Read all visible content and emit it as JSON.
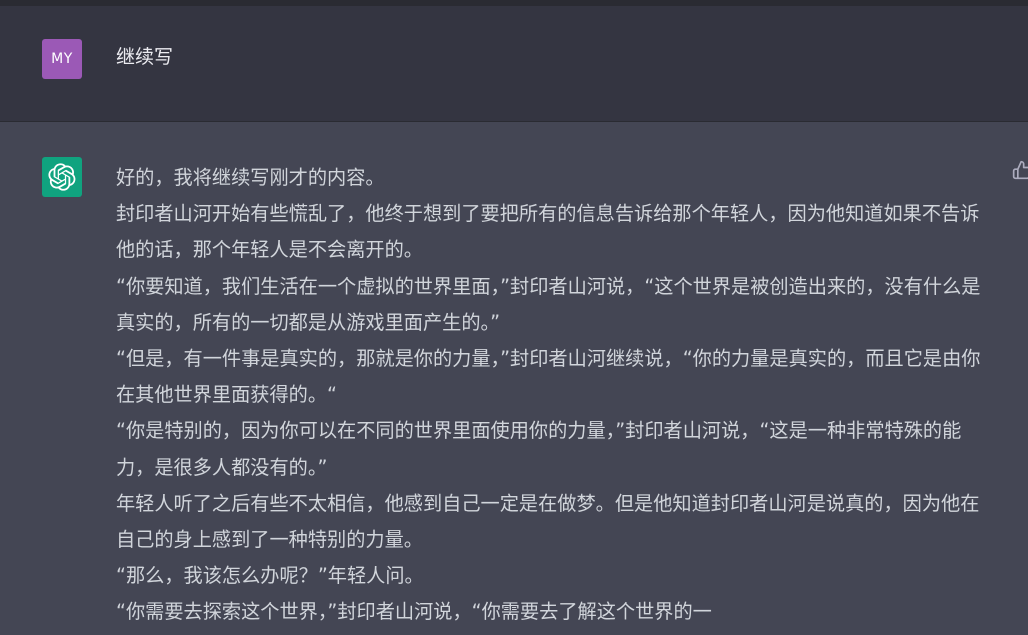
{
  "user_message": {
    "avatar_initials": "MY",
    "avatar_color": "#9b59b6",
    "text": "继续写"
  },
  "assistant_message": {
    "avatar_icon": "openai-logo-icon",
    "avatar_color": "#10a37f",
    "paragraphs": [
      "好的，我将继续写刚才的内容。",
      "封印者山河开始有些慌乱了，他终于想到了要把所有的信息告诉给那个年轻人，因为他知道如果不告诉他的话，那个年轻人是不会离开的。",
      "“你要知道，我们生活在一个虚拟的世界里面，”封印者山河说，“这个世界是被创造出来的，没有什么是真实的，所有的一切都是从游戏里面产生的。”",
      "“但是，有一件事是真实的，那就是你的力量，”封印者山河继续说，“你的力量是真实的，而且它是由你在其他世界里面获得的。“",
      "“你是特别的，因为你可以在不同的世界里面使用你的力量，”封印者山河说，“这是一种非常特殊的能力，是很多人都没有的。”",
      "年轻人听了之后有些不太相信，他感到自己一定是在做梦。但是他知道封印者山河是说真的，因为他在自己的身上感到了一种特别的力量。",
      "“那么，我该怎么办呢？”年轻人问。",
      "“你需要去探索这个世界，”封印者山河说，“你需要去了解这个世界的一"
    ]
  }
}
